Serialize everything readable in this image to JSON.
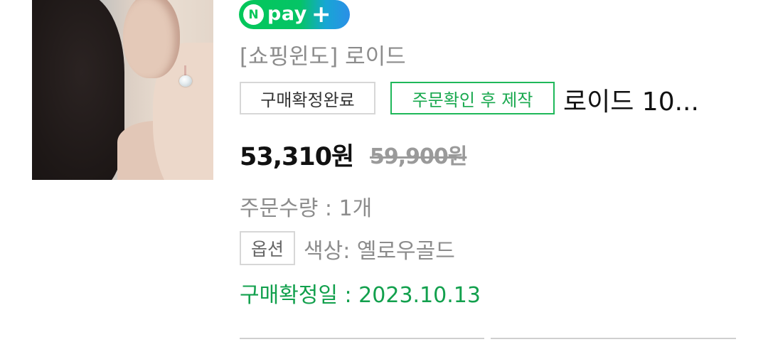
{
  "order_item": {
    "npay_badge": {
      "circle": "N",
      "text": "pay",
      "plus": "+"
    },
    "seller": "[쇼핑윈도] 로이드",
    "status_tag": "구매확정완료",
    "production_tag": "주문확인 후 제작",
    "product_name": "로이드 10...",
    "price": "53,310원",
    "original_price": "59,900원",
    "quantity": "주문수량 : 1개",
    "option_label": "옵션",
    "option_value": "색상: 옐로우골드",
    "confirm_date": "구매확정일 : 2023.10.13"
  },
  "colors": {
    "npay_green": "#03c75a",
    "npay_blue": "#2b8fe7",
    "confirm_green": "#12a04d",
    "muted_gray": "#8c8c8c"
  },
  "icons": [
    "product-thumbnail",
    "npay-plus-logo"
  ]
}
